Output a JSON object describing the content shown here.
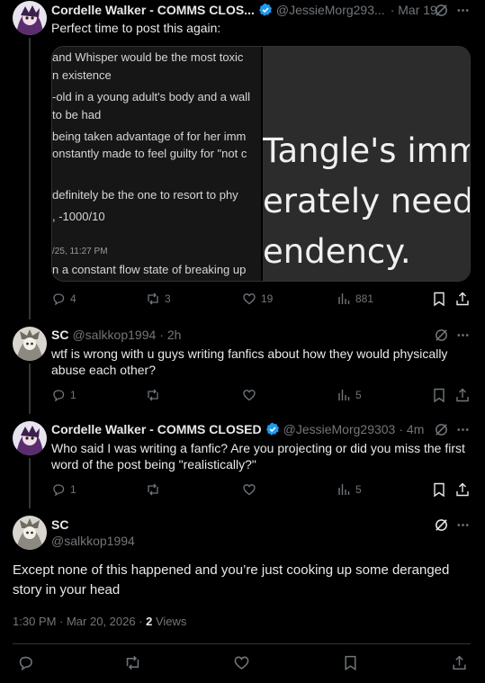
{
  "tweet1": {
    "name": "Cordelle Walker - COMMS CLOS...",
    "handle": "@JessieMorg293...",
    "date": "· Mar 19",
    "text": "Perfect time to post this again:",
    "media_left_lines": [
      "and Whisper would be the most toxic",
      "n existence",
      "-old in a young adult's body and a wall",
      " to be had",
      " being taken advantage of for her imm",
      "onstantly made to feel guilty for \"not c",
      "",
      " definitely be the one to resort to phy",
      ", -1000/10",
      "",
      "/25, 11:27 PM",
      "n a constant flow state of breaking up"
    ],
    "media_right_lines": [
      "Tangle's imma",
      "erately needs",
      "endency."
    ],
    "replies": "4",
    "reposts": "3",
    "likes": "19",
    "views": "881"
  },
  "tweet2": {
    "name": "SC",
    "handle": "@salkkop1994",
    "date": "· 2h",
    "text": "wtf is wrong with u guys writing fanfics about how they would physically abuse each other?",
    "replies": "1",
    "views": "5"
  },
  "tweet3": {
    "name": "Cordelle Walker - COMMS CLOSED",
    "handle": "@JessieMorg29303",
    "date": "· 4m",
    "text": "Who said I was writing a fanfic? Are you projecting or did you miss the first word of the post being \"realistically?\"",
    "replies": "1",
    "views": "5"
  },
  "main": {
    "name": "SC",
    "handle": "@salkkop1994",
    "text": "Except none of this happened and you’re just cooking up some deranged story in your head",
    "timestamp": "1:30 PM · Mar 20, 2026 · ",
    "views_count": "2",
    "views_label": " Views"
  },
  "colors": {
    "background": "#000000",
    "text": "#e7e9ea",
    "muted": "#71767b",
    "verified": "#1d9bf0",
    "divider": "#2f3336"
  },
  "icons": [
    "verified-badge-icon",
    "grok-icon",
    "more-icon",
    "reply-icon",
    "repost-icon",
    "like-icon",
    "views-icon",
    "bookmark-icon",
    "share-icon"
  ]
}
